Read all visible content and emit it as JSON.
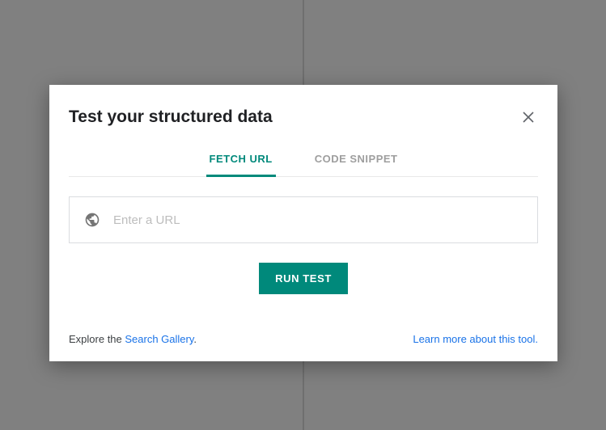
{
  "modal": {
    "title": "Test your structured data",
    "tabs": {
      "fetch_url": "FETCH URL",
      "code_snippet": "CODE SNIPPET"
    },
    "input": {
      "placeholder": "Enter a URL",
      "value": ""
    },
    "run_button": "RUN TEST",
    "footer": {
      "explore_prefix": "Explore the ",
      "search_gallery": "Search Gallery",
      "explore_suffix": ".",
      "learn_more": "Learn more about this tool."
    }
  },
  "colors": {
    "accent": "#00897b",
    "link": "#1a73e8"
  }
}
